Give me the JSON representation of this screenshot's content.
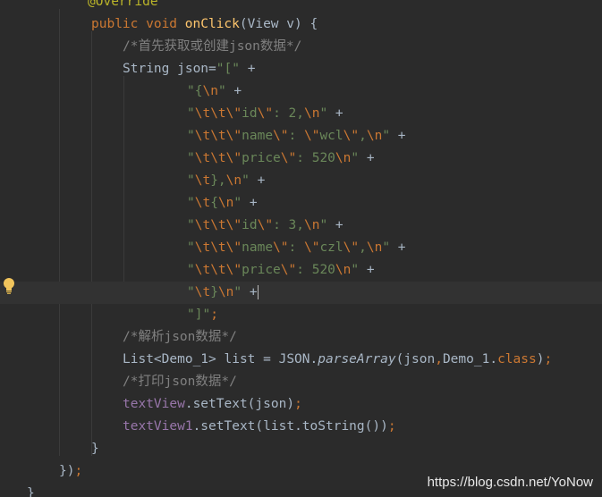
{
  "editor": {
    "lines": [
      [
        {
          "t": "@Override",
          "c": "ann"
        }
      ],
      [
        {
          "t": "public ",
          "c": "kw"
        },
        {
          "t": "void ",
          "c": "kw"
        },
        {
          "t": "onClick",
          "c": "fn"
        },
        {
          "t": "(View v) {",
          "c": "plain"
        }
      ],
      [
        {
          "t": "/*首先获取或创建json数据*/",
          "c": "cmt"
        }
      ],
      [
        {
          "t": "String json=",
          "c": "plain"
        },
        {
          "t": "\"[\"",
          "c": "str"
        },
        {
          "t": " +",
          "c": "plain"
        }
      ],
      [
        {
          "t": "\"{",
          "c": "str"
        },
        {
          "t": "\\n",
          "c": "esc"
        },
        {
          "t": "\"",
          "c": "str"
        },
        {
          "t": " +",
          "c": "plain"
        }
      ],
      [
        {
          "t": "\"",
          "c": "str"
        },
        {
          "t": "\\t\\t\\\"",
          "c": "esc"
        },
        {
          "t": "id",
          "c": "str"
        },
        {
          "t": "\\\"",
          "c": "esc"
        },
        {
          "t": ": 2,",
          "c": "str"
        },
        {
          "t": "\\n",
          "c": "esc"
        },
        {
          "t": "\"",
          "c": "str"
        },
        {
          "t": " +",
          "c": "plain"
        }
      ],
      [
        {
          "t": "\"",
          "c": "str"
        },
        {
          "t": "\\t\\t\\\"",
          "c": "esc"
        },
        {
          "t": "name",
          "c": "str"
        },
        {
          "t": "\\\"",
          "c": "esc"
        },
        {
          "t": ": ",
          "c": "str"
        },
        {
          "t": "\\\"",
          "c": "esc"
        },
        {
          "t": "wcl",
          "c": "str"
        },
        {
          "t": "\\\"",
          "c": "esc"
        },
        {
          "t": ",",
          "c": "str"
        },
        {
          "t": "\\n",
          "c": "esc"
        },
        {
          "t": "\"",
          "c": "str"
        },
        {
          "t": " +",
          "c": "plain"
        }
      ],
      [
        {
          "t": "\"",
          "c": "str"
        },
        {
          "t": "\\t\\t\\\"",
          "c": "esc"
        },
        {
          "t": "price",
          "c": "str"
        },
        {
          "t": "\\\"",
          "c": "esc"
        },
        {
          "t": ": 520",
          "c": "str"
        },
        {
          "t": "\\n",
          "c": "esc"
        },
        {
          "t": "\"",
          "c": "str"
        },
        {
          "t": " +",
          "c": "plain"
        }
      ],
      [
        {
          "t": "\"",
          "c": "str"
        },
        {
          "t": "\\t",
          "c": "esc"
        },
        {
          "t": "},",
          "c": "str"
        },
        {
          "t": "\\n",
          "c": "esc"
        },
        {
          "t": "\"",
          "c": "str"
        },
        {
          "t": " +",
          "c": "plain"
        }
      ],
      [
        {
          "t": "\"",
          "c": "str"
        },
        {
          "t": "\\t",
          "c": "esc"
        },
        {
          "t": "{",
          "c": "str"
        },
        {
          "t": "\\n",
          "c": "esc"
        },
        {
          "t": "\"",
          "c": "str"
        },
        {
          "t": " +",
          "c": "plain"
        }
      ],
      [
        {
          "t": "\"",
          "c": "str"
        },
        {
          "t": "\\t\\t\\\"",
          "c": "esc"
        },
        {
          "t": "id",
          "c": "str"
        },
        {
          "t": "\\\"",
          "c": "esc"
        },
        {
          "t": ": 3,",
          "c": "str"
        },
        {
          "t": "\\n",
          "c": "esc"
        },
        {
          "t": "\"",
          "c": "str"
        },
        {
          "t": " +",
          "c": "plain"
        }
      ],
      [
        {
          "t": "\"",
          "c": "str"
        },
        {
          "t": "\\t\\t\\\"",
          "c": "esc"
        },
        {
          "t": "name",
          "c": "str"
        },
        {
          "t": "\\\"",
          "c": "esc"
        },
        {
          "t": ": ",
          "c": "str"
        },
        {
          "t": "\\\"",
          "c": "esc"
        },
        {
          "t": "czl",
          "c": "str"
        },
        {
          "t": "\\\"",
          "c": "esc"
        },
        {
          "t": ",",
          "c": "str"
        },
        {
          "t": "\\n",
          "c": "esc"
        },
        {
          "t": "\"",
          "c": "str"
        },
        {
          "t": " +",
          "c": "plain"
        }
      ],
      [
        {
          "t": "\"",
          "c": "str"
        },
        {
          "t": "\\t\\t\\\"",
          "c": "esc"
        },
        {
          "t": "price",
          "c": "str"
        },
        {
          "t": "\\\"",
          "c": "esc"
        },
        {
          "t": ": 520",
          "c": "str"
        },
        {
          "t": "\\n",
          "c": "esc"
        },
        {
          "t": "\"",
          "c": "str"
        },
        {
          "t": " +",
          "c": "plain"
        }
      ],
      [
        {
          "t": "\"",
          "c": "str"
        },
        {
          "t": "\\t",
          "c": "esc"
        },
        {
          "t": "}",
          "c": "str"
        },
        {
          "t": "\\n",
          "c": "esc"
        },
        {
          "t": "\"",
          "c": "str"
        },
        {
          "t": " +",
          "c": "plain"
        }
      ],
      [
        {
          "t": "\"]\"",
          "c": "str"
        },
        {
          "t": ";",
          "c": "kw"
        }
      ],
      [
        {
          "t": "/*解析json数据*/",
          "c": "cmt"
        }
      ],
      [
        {
          "t": "List<Demo_1> list = JSON.",
          "c": "plain"
        },
        {
          "t": "parseArray",
          "c": "sfn"
        },
        {
          "t": "(json",
          "c": "plain"
        },
        {
          "t": ",",
          "c": "kw"
        },
        {
          "t": "Demo_1.",
          "c": "plain"
        },
        {
          "t": "class",
          "c": "kw"
        },
        {
          "t": ")",
          "c": "plain"
        },
        {
          "t": ";",
          "c": "kw"
        }
      ],
      [
        {
          "t": "/*打印json数据*/",
          "c": "cmt"
        }
      ],
      [
        {
          "t": "textView",
          "c": "fld"
        },
        {
          "t": ".setText(json)",
          "c": "plain"
        },
        {
          "t": ";",
          "c": "kw"
        }
      ],
      [
        {
          "t": "textView1",
          "c": "fld"
        },
        {
          "t": ".setText(list.toString())",
          "c": "plain"
        },
        {
          "t": ";",
          "c": "kw"
        }
      ],
      [
        {
          "t": "}",
          "c": "plain"
        }
      ],
      [
        {
          "t": "})",
          "c": "plain"
        },
        {
          "t": ";",
          "c": "kw"
        }
      ],
      [
        {
          "t": "}",
          "c": "plain"
        }
      ]
    ]
  },
  "intention_icon": "lightbulb-icon",
  "watermark": "https://blog.csdn.net/YoNow",
  "colors": {
    "background": "#2b2b2b",
    "current_line": "#323232",
    "keyword": "#cc7832",
    "annotation": "#bbb529",
    "method": "#ffc66d",
    "string": "#6a8759",
    "number": "#6897bb",
    "comment": "#808080",
    "field": "#9876aa",
    "text": "#a9b7c6",
    "bulb": "#f2c55c"
  }
}
